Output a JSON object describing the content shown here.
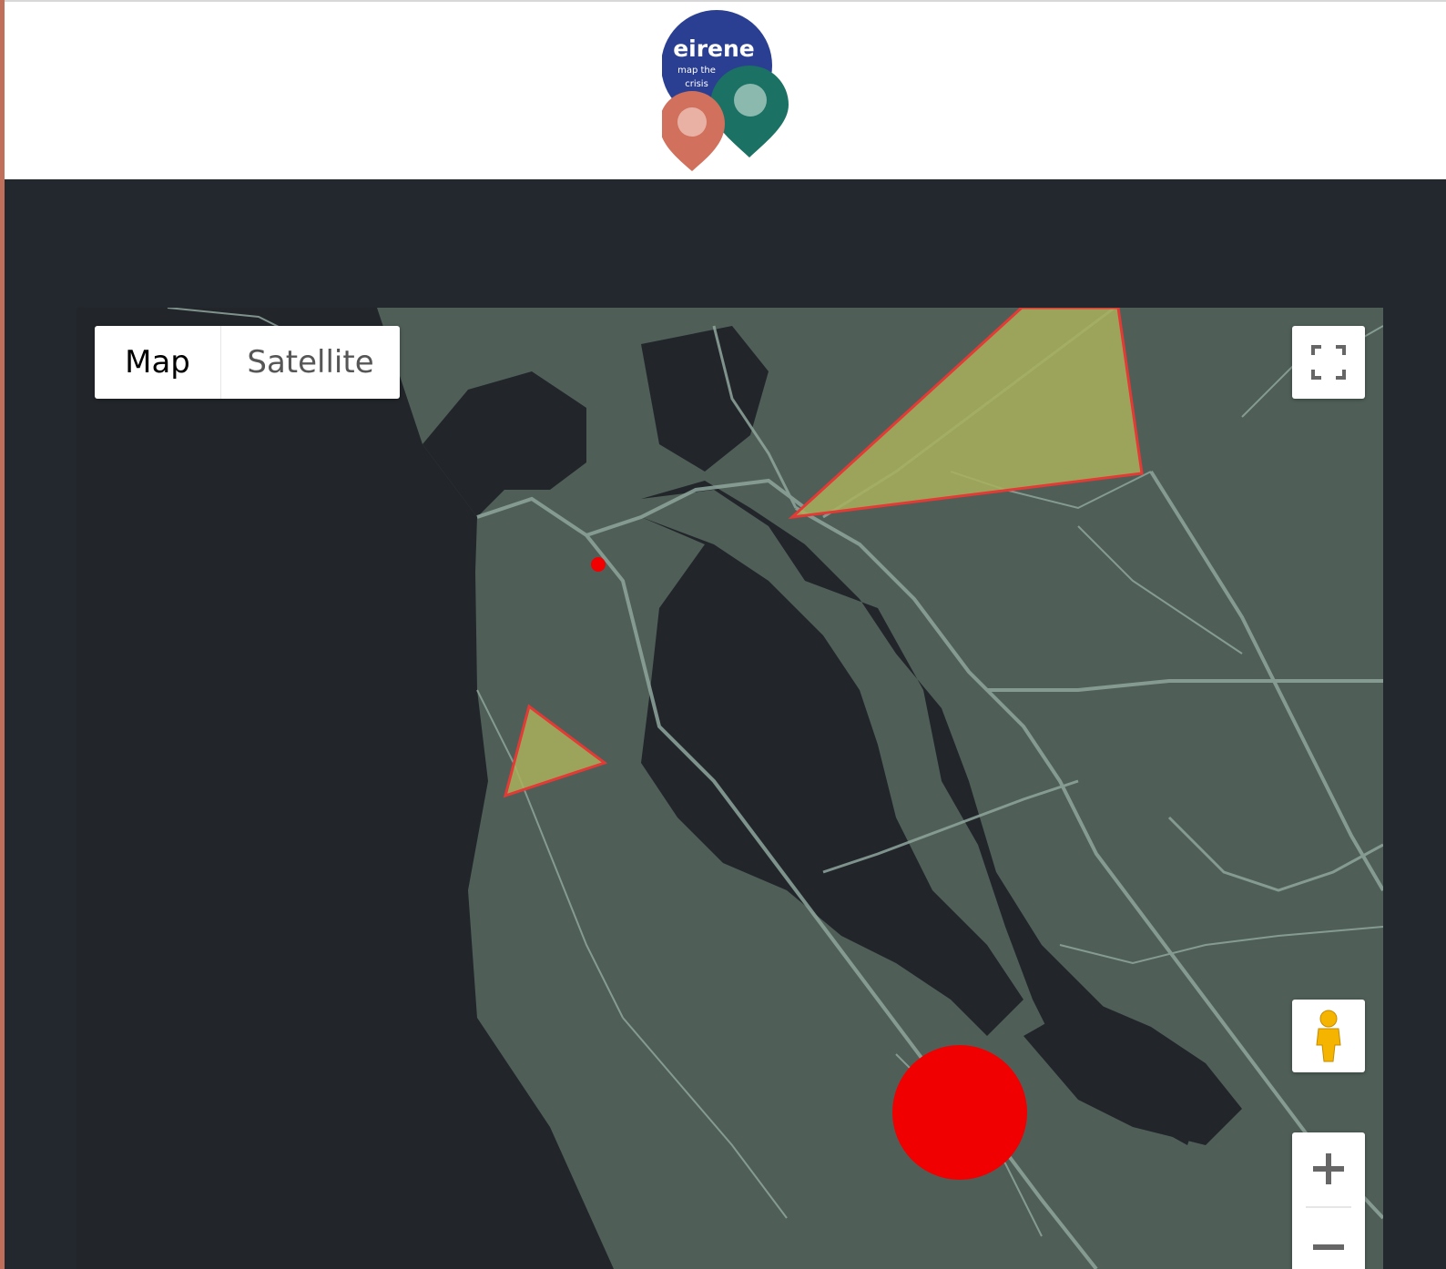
{
  "header": {
    "logo": {
      "name": "eirene",
      "tagline_line1": "map the",
      "tagline_line2": "crisis"
    }
  },
  "map": {
    "type_control": {
      "map_label": "Map",
      "satellite_label": "Satellite",
      "selected": "Map"
    },
    "controls": {
      "fullscreen_icon": "fullscreen-icon",
      "pegman_icon": "pegman-icon",
      "zoom_in_icon": "plus-icon",
      "zoom_out_icon": "minus-icon"
    },
    "colors": {
      "land": "#4f5f58",
      "water": "#22262a",
      "roads": "#8fa69c",
      "polygon_fill": "#a8b05a",
      "polygon_stroke": "#e53935",
      "marker": "#f00000"
    }
  }
}
